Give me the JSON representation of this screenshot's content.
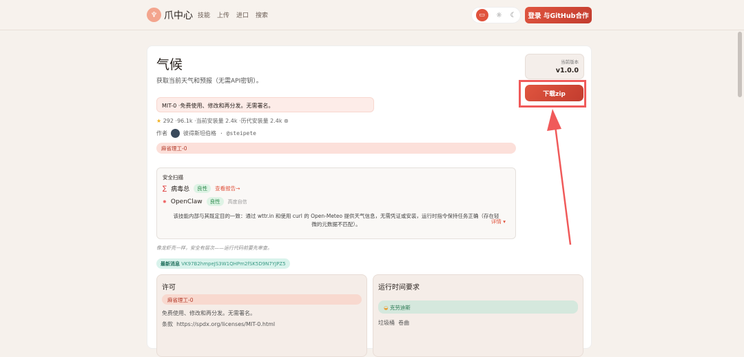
{
  "header": {
    "brand": "爪中心",
    "nav": [
      "技能",
      "上传",
      "进口",
      "搜索"
    ],
    "login": "登录 与GitHub合作"
  },
  "skill": {
    "title": "气候",
    "description": "获取当前天气和预报（无需API密钥）。",
    "license_notice": "MIT-0 ·免费使用、修改和再分发。无需署名。",
    "stats": "292 ·96.1k ·当前安装量 2.4k ·历代安装量 2.4k",
    "author_label": "作者",
    "author_name": "彼得斯坦伯格",
    "author_handle": "· @steipete",
    "license_tag": "麻省理工-0"
  },
  "scan": {
    "title": "安全扫描",
    "virustotal": "病毒总",
    "virustotal_status": "良性",
    "report_link": "查看报告→",
    "openclaw": "OpenClaw",
    "openclaw_status": "良性",
    "confidence": "高度自信",
    "summary": "该技能内部与其既定目的一致：通过 wttr.in 和使用 curl 的 Open-Meteo 提供天气信息，无需凭证或安装，运行时指令保持任务正确（存在轻微的元数据不匹配）。",
    "details": "详情 ▾"
  },
  "tip": "像龙虾壳一样，安全有层次——运行代码前要先审查。",
  "latest": {
    "label": "最新消息",
    "hash": "VK97B2hmpeJS3W1QHPm2fSK5D9N7YJPZ5"
  },
  "license_box": {
    "title": "许可",
    "tag": "麻省理工-0",
    "text": "免费使用、修改和再分发。无需署名。",
    "terms_label": "条款",
    "terms_url": "https://spdx.org/licenses/MIT-0.html"
  },
  "runtime_box": {
    "title": "运行时间要求",
    "requirement": "克劳迪斯",
    "bin_label": "垃圾桶",
    "bin_value": "卷曲"
  },
  "version": {
    "label": "当前版本",
    "value": "v1.0.0"
  },
  "download": "下载zip"
}
